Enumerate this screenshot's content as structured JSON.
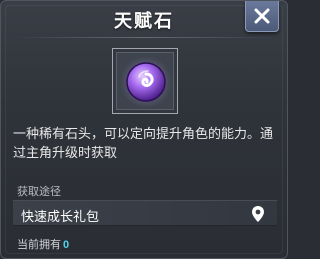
{
  "dialog": {
    "title": "天赋石",
    "close_icon": "close-x-icon",
    "item_icon": "purple-spiral-gem-icon",
    "description": "一种稀有石头，可以定向提升角色的能力。通过主角升级时获取",
    "source_section_label": "获取途径",
    "sources": [
      {
        "label": "快速成长礼包",
        "icon": "location-pin-icon"
      }
    ],
    "owned_label": "当前拥有",
    "owned_count": "0"
  },
  "colors": {
    "accent_cyan": "#4fd4f0",
    "gem_purple": "#a66bf0",
    "close_button": "#5b6a8a"
  }
}
